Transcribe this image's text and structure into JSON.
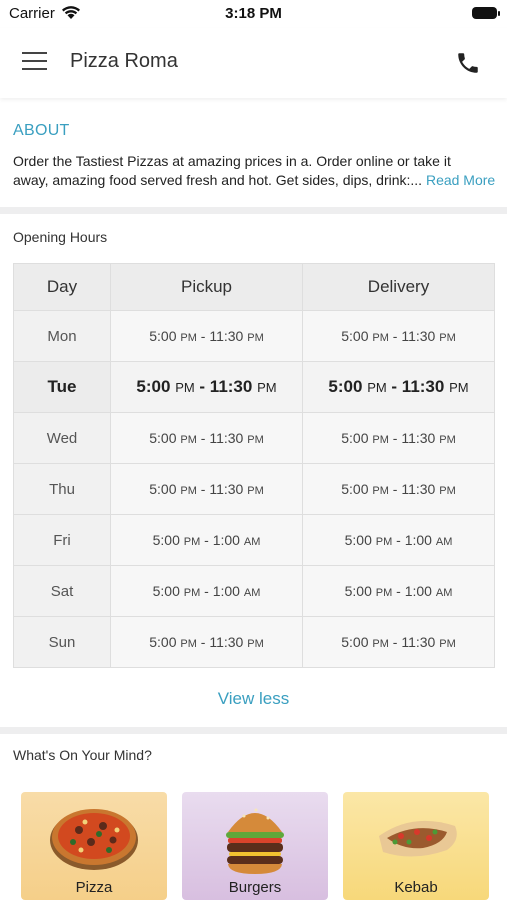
{
  "status_bar": {
    "carrier": "Carrier",
    "time": "3:18 PM"
  },
  "header": {
    "title": "Pizza Roma"
  },
  "about": {
    "heading": "ABOUT",
    "line1": "Order the Tastiest Pizzas at amazing prices in a. Order online or take it",
    "line2": "away, amazing food served fresh and hot. Get sides, dips, drink:...",
    "read_more": "Read More"
  },
  "opening_hours": {
    "heading": "Opening Hours",
    "columns": [
      "Day",
      "Pickup",
      "Delivery"
    ],
    "rows": [
      {
        "day": "Mon",
        "pickup": [
          "5:00",
          "PM",
          "11:30",
          "PM"
        ],
        "delivery": [
          "5:00",
          "PM",
          "11:30",
          "PM"
        ]
      },
      {
        "day": "Tue",
        "pickup": [
          "5:00",
          "PM",
          "11:30",
          "PM"
        ],
        "delivery": [
          "5:00",
          "PM",
          "11:30",
          "PM"
        ]
      },
      {
        "day": "Wed",
        "pickup": [
          "5:00",
          "PM",
          "11:30",
          "PM"
        ],
        "delivery": [
          "5:00",
          "PM",
          "11:30",
          "PM"
        ]
      },
      {
        "day": "Thu",
        "pickup": [
          "5:00",
          "PM",
          "11:30",
          "PM"
        ],
        "delivery": [
          "5:00",
          "PM",
          "11:30",
          "PM"
        ]
      },
      {
        "day": "Fri",
        "pickup": [
          "5:00",
          "PM",
          "1:00",
          "AM"
        ],
        "delivery": [
          "5:00",
          "PM",
          "1:00",
          "AM"
        ]
      },
      {
        "day": "Sat",
        "pickup": [
          "5:00",
          "PM",
          "1:00",
          "AM"
        ],
        "delivery": [
          "5:00",
          "PM",
          "1:00",
          "AM"
        ]
      },
      {
        "day": "Sun",
        "pickup": [
          "5:00",
          "PM",
          "11:30",
          "PM"
        ],
        "delivery": [
          "5:00",
          "PM",
          "11:30",
          "PM"
        ]
      }
    ],
    "today_index": 1,
    "toggle_label": "View less"
  },
  "categories": {
    "heading": "What's On Your Mind?",
    "items": [
      {
        "label": "Pizza",
        "icon": "pizza-icon"
      },
      {
        "label": "Burgers",
        "icon": "burger-icon"
      },
      {
        "label": "Kebab",
        "icon": "kebab-icon"
      }
    ]
  },
  "colors": {
    "accent": "#3a9fc0",
    "separator": "#eeeeef",
    "table_header": "#ececec"
  }
}
